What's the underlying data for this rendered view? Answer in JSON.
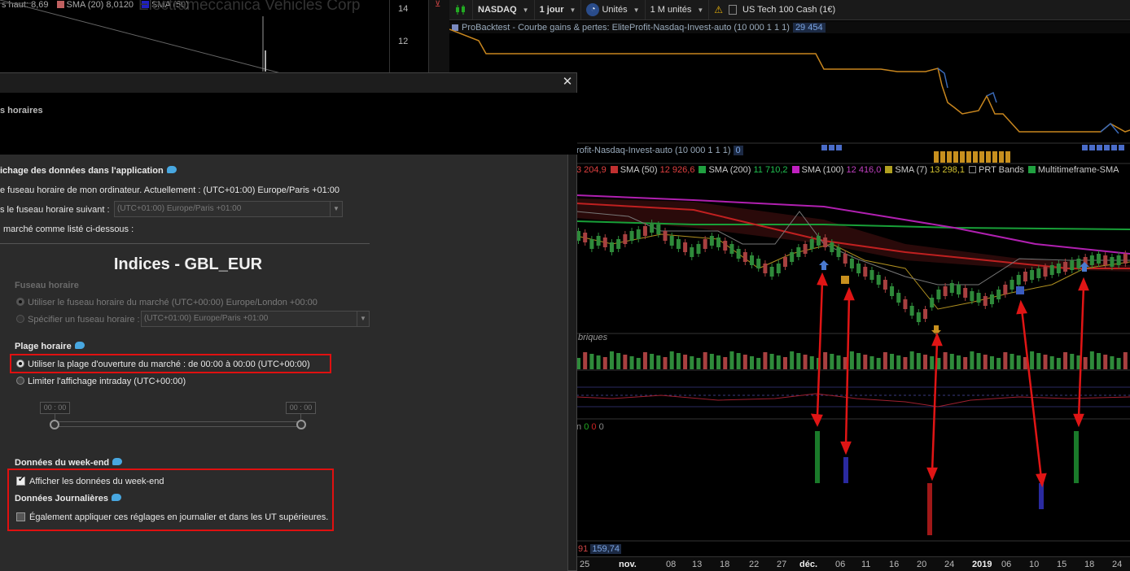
{
  "left_chart": {
    "legend": [
      {
        "text": "s haut: 8,69",
        "color": ""
      },
      {
        "text": "SMA (20) 8,0120",
        "color": "#c06060"
      },
      {
        "text": "SMA (50)",
        "color": "#2020c0"
      }
    ],
    "watermark": "Electrameccanica Vehicles Corp",
    "price_labels": [
      "14",
      "12"
    ]
  },
  "toolbar": {
    "market": "NASDAQ",
    "period": "1 jour",
    "units": "Unités",
    "units_count": "1 M unités",
    "instrument": "US Tech 100 Cash (1€)"
  },
  "backtest": {
    "title": "ProBacktest - Courbe gains & pertes: EliteProfit-Nasdaq-Invest-auto (10 000 1 1 1)",
    "value": "29 454"
  },
  "positions_pane": {
    "title": "rofit-Nasdaq-Invest-auto (10 000 1 1 1)",
    "value": "0"
  },
  "indicators": [
    {
      "text": "3 204,9",
      "color": "",
      "value_color": "#e04040"
    },
    {
      "text": "SMA (50)",
      "color": "#c03030",
      "value": "12 926,6",
      "value_color": "#e04040"
    },
    {
      "text": "SMA (200)",
      "color": "#20a040",
      "value": "11 710,2",
      "value_color": "#20c050"
    },
    {
      "text": "SMA (100)",
      "color": "#c020c0",
      "value": "12 416,0",
      "value_color": "#c040c0"
    },
    {
      "text": "SMA (7)",
      "color": "#b0a020",
      "value": "13 298,1",
      "value_color": "#d0c030"
    },
    {
      "text": "PRT Bands",
      "color": "",
      "value": "",
      "value_color": ""
    },
    {
      "text": "Multitimeframe-SMA",
      "color": "#20a040",
      "value": "",
      "value_color": ""
    }
  ],
  "volume_label": "briques",
  "bottom_left_values": {
    "a": "91",
    "b": "159,74"
  },
  "signal_pane_values": {
    "prefix": "n",
    "v1": "0",
    "v2": "0",
    "v3": "0"
  },
  "date_axis": [
    "25",
    "nov.",
    "08",
    "13",
    "18",
    "22",
    "27",
    "déc.",
    "06",
    "11",
    "16",
    "20",
    "24",
    "2019",
    "06",
    "10",
    "15",
    "18",
    "24"
  ],
  "dialog": {
    "header_title": "s horaires",
    "section_display": "ichage des données dans l'application",
    "opt_computer_tz": "e fuseau horaire de mon ordinateur. Actuellement : (UTC+01:00) Europe/Paris +01:00",
    "opt_following_tz": "s le fuseau horaire suivant :",
    "tz_select_1": "(UTC+01:00) Europe/Paris +01:00",
    "opt_market": "marché comme listé ci-dessous :",
    "market_title": "Indices - GBL_EUR",
    "section_timezone": "Fuseau horaire",
    "opt_market_tz": "Utiliser le fuseau horaire du marché (UTC+00:00) Europe/London +00:00",
    "opt_specify_tz": "Spécifier un fuseau horaire :",
    "tz_select_2": "(UTC+01:00) Europe/Paris +01:00",
    "section_hours": "Plage horaire",
    "opt_open_hours": "Utiliser la plage d'ouverture du marché : de 00:00 à 00:00  (UTC+00:00)",
    "opt_limit_intraday": "Limiter l'affichage intraday  (UTC+00:00)",
    "time_start": "00 : 00",
    "time_end": "00 : 00",
    "section_weekend": "Données du week-end",
    "chk_weekend": "Afficher les données du week-end",
    "section_daily": "Données Journalières",
    "chk_daily": "Également appliquer ces réglages en journalier et dans les UT supérieures."
  }
}
